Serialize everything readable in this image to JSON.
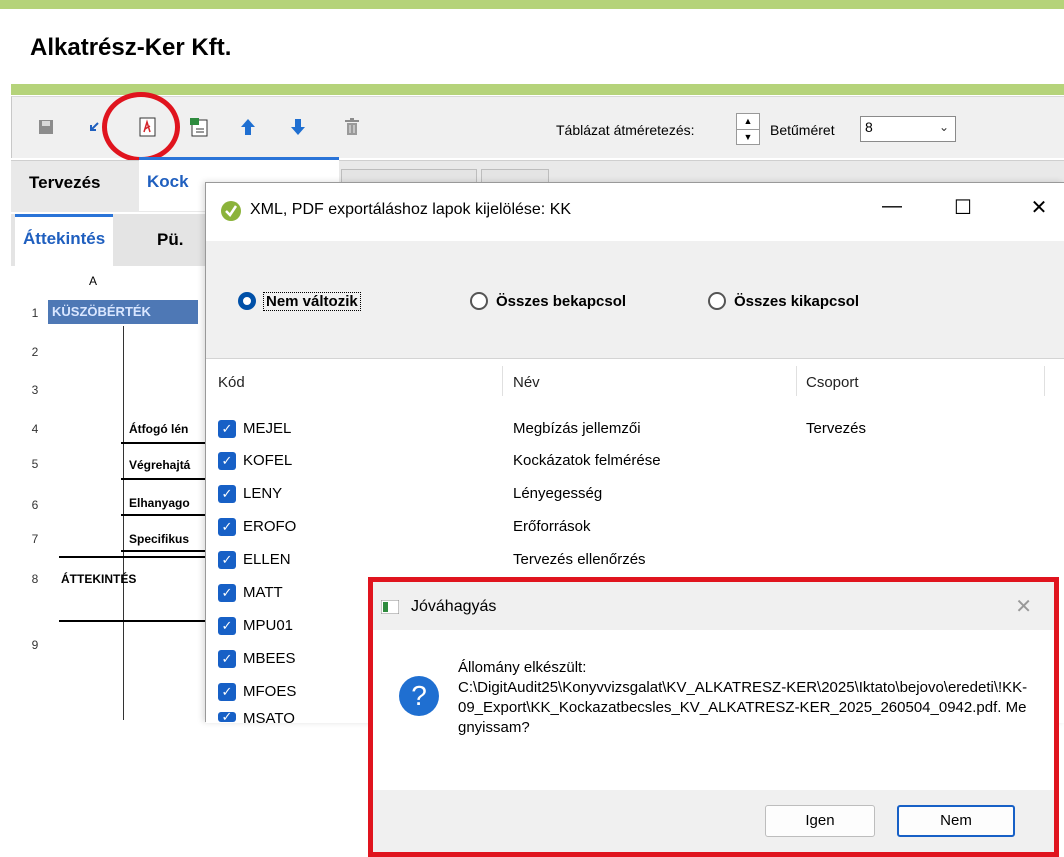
{
  "app": {
    "title": "Alkatrész-Ker Kft.",
    "accent": "#b5d37a"
  },
  "toolbar": {
    "icons": [
      "save-icon",
      "undo-icon",
      "pdf-export-icon",
      "xml-export-icon",
      "arrow-up-icon",
      "arrow-down-icon",
      "trash-icon"
    ],
    "resize_label": "Táblázat átméretezés:",
    "font_label": "Betűméret",
    "font_value": "8"
  },
  "tabs": {
    "main": [
      "Tervezés",
      "Kock"
    ],
    "sub": [
      "Áttekintés",
      "Pü."
    ]
  },
  "sheet": {
    "column_a": "A",
    "header": "KÜSZÖBÉRTÉK",
    "rows": [
      "1",
      "2",
      "3",
      "4",
      "5",
      "6",
      "7",
      "8",
      "9"
    ],
    "cells": [
      "Átfogó lén",
      "Végrehajtá",
      "Elhanyago",
      "Specifikus",
      "ÁTTEKINTÉS"
    ]
  },
  "export_dialog": {
    "title": "XML, PDF exportáláshoz lapok kijelölése: KK",
    "radio_options": [
      "Nem változik",
      "Összes bekapcsol",
      "Összes kikapcsol"
    ],
    "selected_radio": "Nem változik",
    "columns": [
      "Kód",
      "Név",
      "Csoport"
    ],
    "rows": [
      {
        "code": "MEJEL",
        "name": "Megbízás jellemzői",
        "group": "Tervezés",
        "checked": true
      },
      {
        "code": "KOFEL",
        "name": "Kockázatok felmérése",
        "group": "",
        "checked": true
      },
      {
        "code": "LENY",
        "name": "Lényegesség",
        "group": "",
        "checked": true
      },
      {
        "code": "EROFO",
        "name": "Erőforrások",
        "group": "",
        "checked": true
      },
      {
        "code": "ELLEN",
        "name": "Tervezés ellenőrzés",
        "group": "",
        "checked": true
      },
      {
        "code": "MATT",
        "name": "",
        "group": "",
        "checked": true
      },
      {
        "code": "MPU01",
        "name": "",
        "group": "",
        "checked": true
      },
      {
        "code": "MBEES",
        "name": "",
        "group": "",
        "checked": true
      },
      {
        "code": "MFOES",
        "name": "",
        "group": "",
        "checked": true
      },
      {
        "code": "MSATO",
        "name": "",
        "group": "",
        "checked": true
      }
    ]
  },
  "confirm_dialog": {
    "title": "Jóváhagyás",
    "message_line1": "Állomány elkészült:",
    "message_path": "C:\\DigitAudit25\\Konyvvizsgalat\\KV_ALKATRESZ-KER\\2025\\Iktato\\bejovo\\eredeti\\!KK-09_Export\\KK_Kockazatbecsles_KV_ALKATRESZ-KER_2025_260504_0942.pdf. Megnyissam?",
    "yes_label": "Igen",
    "no_label": "Nem",
    "highlight_color": "#e0141e"
  }
}
